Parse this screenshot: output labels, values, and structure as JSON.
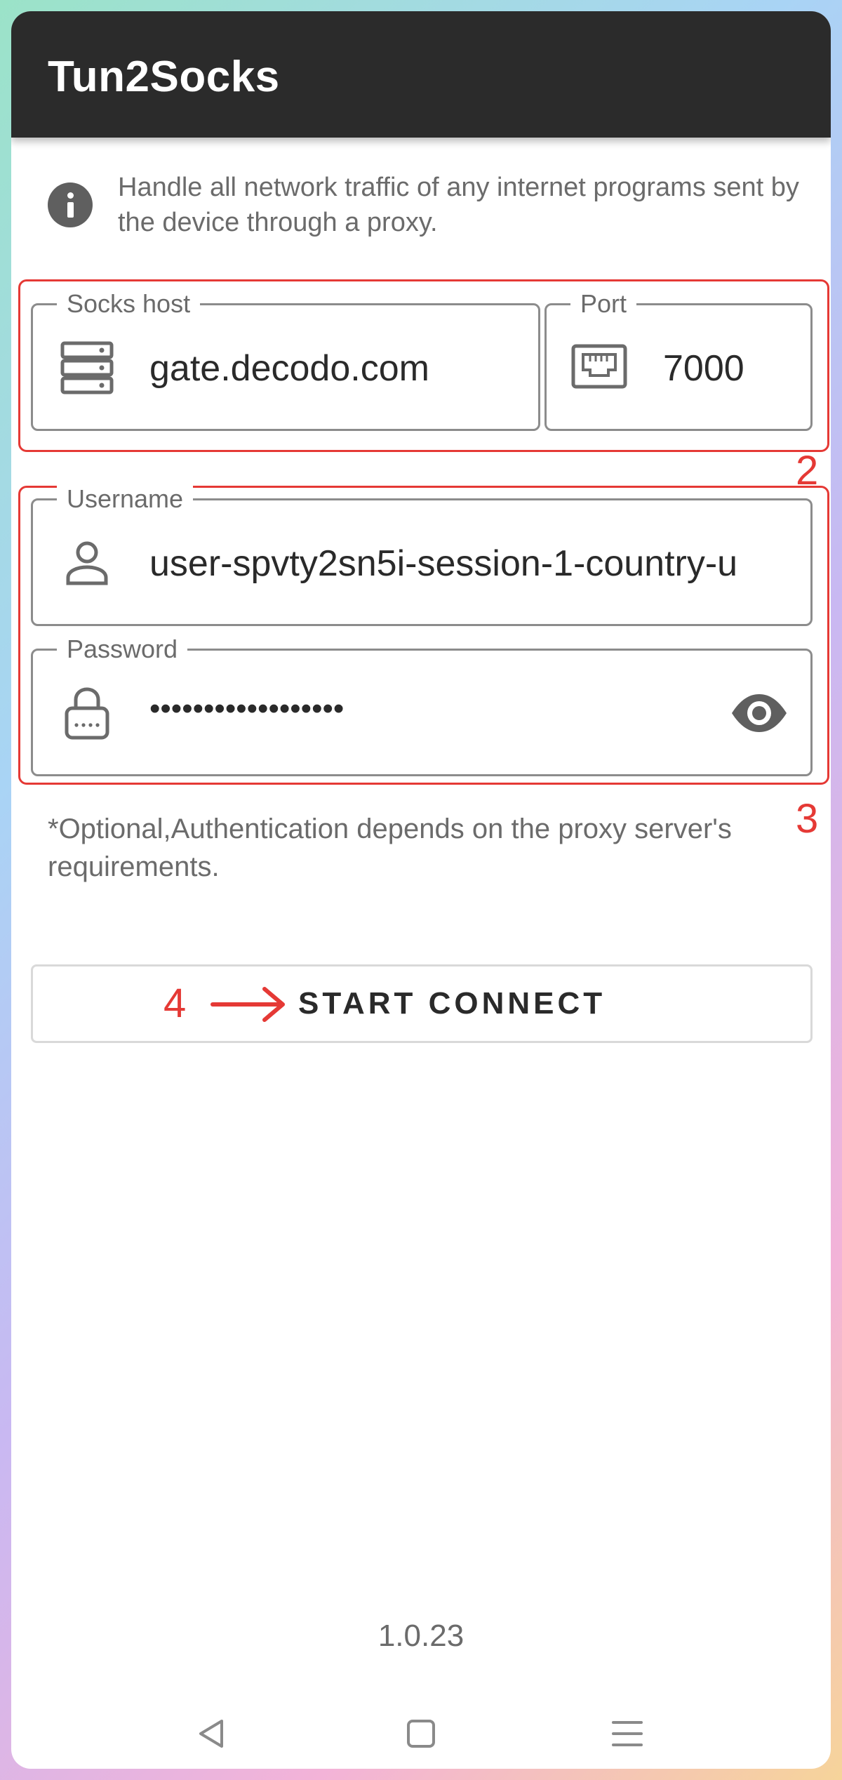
{
  "app": {
    "title": "Tun2Socks"
  },
  "info": {
    "icon": "info-icon",
    "text": "Handle all network traffic of any internet programs sent by the device through a proxy."
  },
  "socks_host": {
    "label": "Socks host",
    "value": "gate.decodo.com",
    "icon": "server-icon"
  },
  "port": {
    "label": "Port",
    "value": "7000",
    "icon": "ethernet-port-icon"
  },
  "username": {
    "label": "Username",
    "value": "user-spvty2sn5i-session-1-country-u",
    "icon": "person-icon"
  },
  "password": {
    "label": "Password",
    "value": "••••••••••••••••••",
    "icon": "lock-icon",
    "toggle_icon": "eye-icon"
  },
  "helper_text": "*Optional,Authentication depends on the proxy server's requirements.",
  "connect": {
    "label": "START CONNECT"
  },
  "annotations": {
    "box2": "2",
    "box3": "3",
    "step4": "4"
  },
  "version": "1.0.23",
  "nav": {
    "back": "back-triangle-icon",
    "home": "home-square-icon",
    "menu": "menu-lines-icon"
  },
  "colors": {
    "appbar": "#2b2b2b",
    "annotation": "#e53935",
    "icon_gray": "#6b6b6b"
  }
}
